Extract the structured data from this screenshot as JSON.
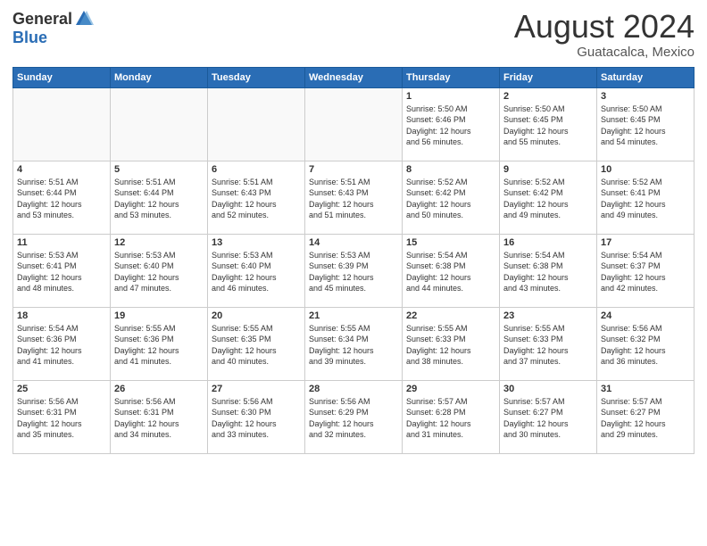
{
  "logo": {
    "general": "General",
    "blue": "Blue"
  },
  "title": "August 2024",
  "location": "Guatacalca, Mexico",
  "days_of_week": [
    "Sunday",
    "Monday",
    "Tuesday",
    "Wednesday",
    "Thursday",
    "Friday",
    "Saturday"
  ],
  "weeks": [
    [
      {
        "num": "",
        "info": ""
      },
      {
        "num": "",
        "info": ""
      },
      {
        "num": "",
        "info": ""
      },
      {
        "num": "",
        "info": ""
      },
      {
        "num": "1",
        "info": "Sunrise: 5:50 AM\nSunset: 6:46 PM\nDaylight: 12 hours\nand 56 minutes."
      },
      {
        "num": "2",
        "info": "Sunrise: 5:50 AM\nSunset: 6:45 PM\nDaylight: 12 hours\nand 55 minutes."
      },
      {
        "num": "3",
        "info": "Sunrise: 5:50 AM\nSunset: 6:45 PM\nDaylight: 12 hours\nand 54 minutes."
      }
    ],
    [
      {
        "num": "4",
        "info": "Sunrise: 5:51 AM\nSunset: 6:44 PM\nDaylight: 12 hours\nand 53 minutes."
      },
      {
        "num": "5",
        "info": "Sunrise: 5:51 AM\nSunset: 6:44 PM\nDaylight: 12 hours\nand 53 minutes."
      },
      {
        "num": "6",
        "info": "Sunrise: 5:51 AM\nSunset: 6:43 PM\nDaylight: 12 hours\nand 52 minutes."
      },
      {
        "num": "7",
        "info": "Sunrise: 5:51 AM\nSunset: 6:43 PM\nDaylight: 12 hours\nand 51 minutes."
      },
      {
        "num": "8",
        "info": "Sunrise: 5:52 AM\nSunset: 6:42 PM\nDaylight: 12 hours\nand 50 minutes."
      },
      {
        "num": "9",
        "info": "Sunrise: 5:52 AM\nSunset: 6:42 PM\nDaylight: 12 hours\nand 49 minutes."
      },
      {
        "num": "10",
        "info": "Sunrise: 5:52 AM\nSunset: 6:41 PM\nDaylight: 12 hours\nand 49 minutes."
      }
    ],
    [
      {
        "num": "11",
        "info": "Sunrise: 5:53 AM\nSunset: 6:41 PM\nDaylight: 12 hours\nand 48 minutes."
      },
      {
        "num": "12",
        "info": "Sunrise: 5:53 AM\nSunset: 6:40 PM\nDaylight: 12 hours\nand 47 minutes."
      },
      {
        "num": "13",
        "info": "Sunrise: 5:53 AM\nSunset: 6:40 PM\nDaylight: 12 hours\nand 46 minutes."
      },
      {
        "num": "14",
        "info": "Sunrise: 5:53 AM\nSunset: 6:39 PM\nDaylight: 12 hours\nand 45 minutes."
      },
      {
        "num": "15",
        "info": "Sunrise: 5:54 AM\nSunset: 6:38 PM\nDaylight: 12 hours\nand 44 minutes."
      },
      {
        "num": "16",
        "info": "Sunrise: 5:54 AM\nSunset: 6:38 PM\nDaylight: 12 hours\nand 43 minutes."
      },
      {
        "num": "17",
        "info": "Sunrise: 5:54 AM\nSunset: 6:37 PM\nDaylight: 12 hours\nand 42 minutes."
      }
    ],
    [
      {
        "num": "18",
        "info": "Sunrise: 5:54 AM\nSunset: 6:36 PM\nDaylight: 12 hours\nand 41 minutes."
      },
      {
        "num": "19",
        "info": "Sunrise: 5:55 AM\nSunset: 6:36 PM\nDaylight: 12 hours\nand 41 minutes."
      },
      {
        "num": "20",
        "info": "Sunrise: 5:55 AM\nSunset: 6:35 PM\nDaylight: 12 hours\nand 40 minutes."
      },
      {
        "num": "21",
        "info": "Sunrise: 5:55 AM\nSunset: 6:34 PM\nDaylight: 12 hours\nand 39 minutes."
      },
      {
        "num": "22",
        "info": "Sunrise: 5:55 AM\nSunset: 6:33 PM\nDaylight: 12 hours\nand 38 minutes."
      },
      {
        "num": "23",
        "info": "Sunrise: 5:55 AM\nSunset: 6:33 PM\nDaylight: 12 hours\nand 37 minutes."
      },
      {
        "num": "24",
        "info": "Sunrise: 5:56 AM\nSunset: 6:32 PM\nDaylight: 12 hours\nand 36 minutes."
      }
    ],
    [
      {
        "num": "25",
        "info": "Sunrise: 5:56 AM\nSunset: 6:31 PM\nDaylight: 12 hours\nand 35 minutes."
      },
      {
        "num": "26",
        "info": "Sunrise: 5:56 AM\nSunset: 6:31 PM\nDaylight: 12 hours\nand 34 minutes."
      },
      {
        "num": "27",
        "info": "Sunrise: 5:56 AM\nSunset: 6:30 PM\nDaylight: 12 hours\nand 33 minutes."
      },
      {
        "num": "28",
        "info": "Sunrise: 5:56 AM\nSunset: 6:29 PM\nDaylight: 12 hours\nand 32 minutes."
      },
      {
        "num": "29",
        "info": "Sunrise: 5:57 AM\nSunset: 6:28 PM\nDaylight: 12 hours\nand 31 minutes."
      },
      {
        "num": "30",
        "info": "Sunrise: 5:57 AM\nSunset: 6:27 PM\nDaylight: 12 hours\nand 30 minutes."
      },
      {
        "num": "31",
        "info": "Sunrise: 5:57 AM\nSunset: 6:27 PM\nDaylight: 12 hours\nand 29 minutes."
      }
    ]
  ]
}
